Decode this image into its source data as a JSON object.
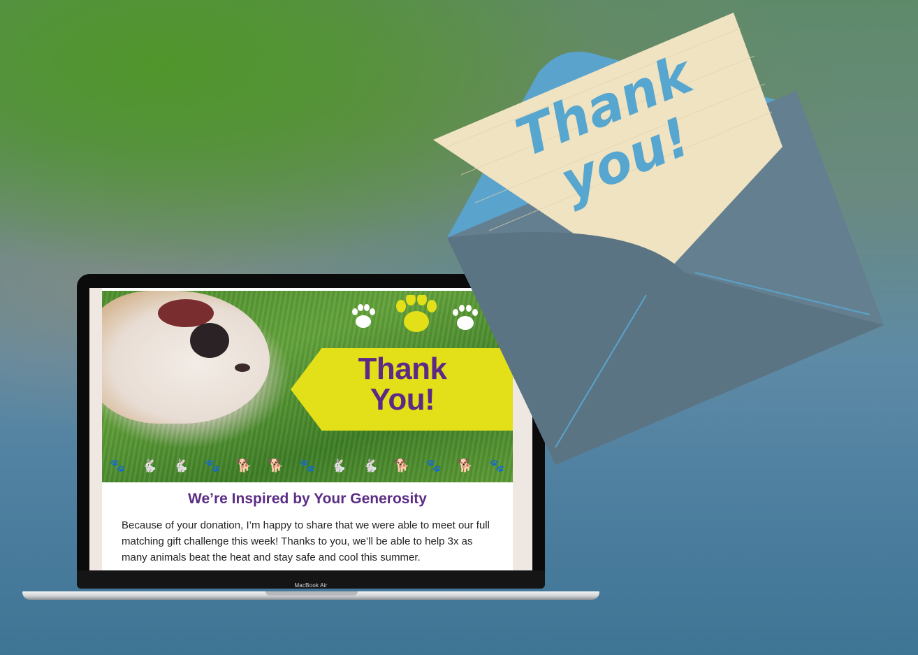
{
  "email": {
    "banner": {
      "line1": "Thank",
      "line2": "You!"
    },
    "headline": "We’re Inspired by Your Generosity",
    "body": "Because of your donation, I’m happy to share that we were able to meet our full matching gift challenge this week! Thanks to you, we’ll be able to help 3x as many animals beat the heat and stay safe and cool this summer."
  },
  "laptop": {
    "label": "MacBook Air"
  },
  "card_note": {
    "line1": "Thank",
    "line2": "you!"
  },
  "colors": {
    "banner_yellow": "#e3df18",
    "headline_purple": "#5b2d85",
    "note_script_blue": "#57a6cf",
    "envelope_body": "#566f7e",
    "envelope_flap": "#6c8796",
    "note_paper": "#efe3c2"
  },
  "icons": [
    "paw-icon",
    "rabbit-icon",
    "dog-icon",
    "envelope-icon"
  ]
}
